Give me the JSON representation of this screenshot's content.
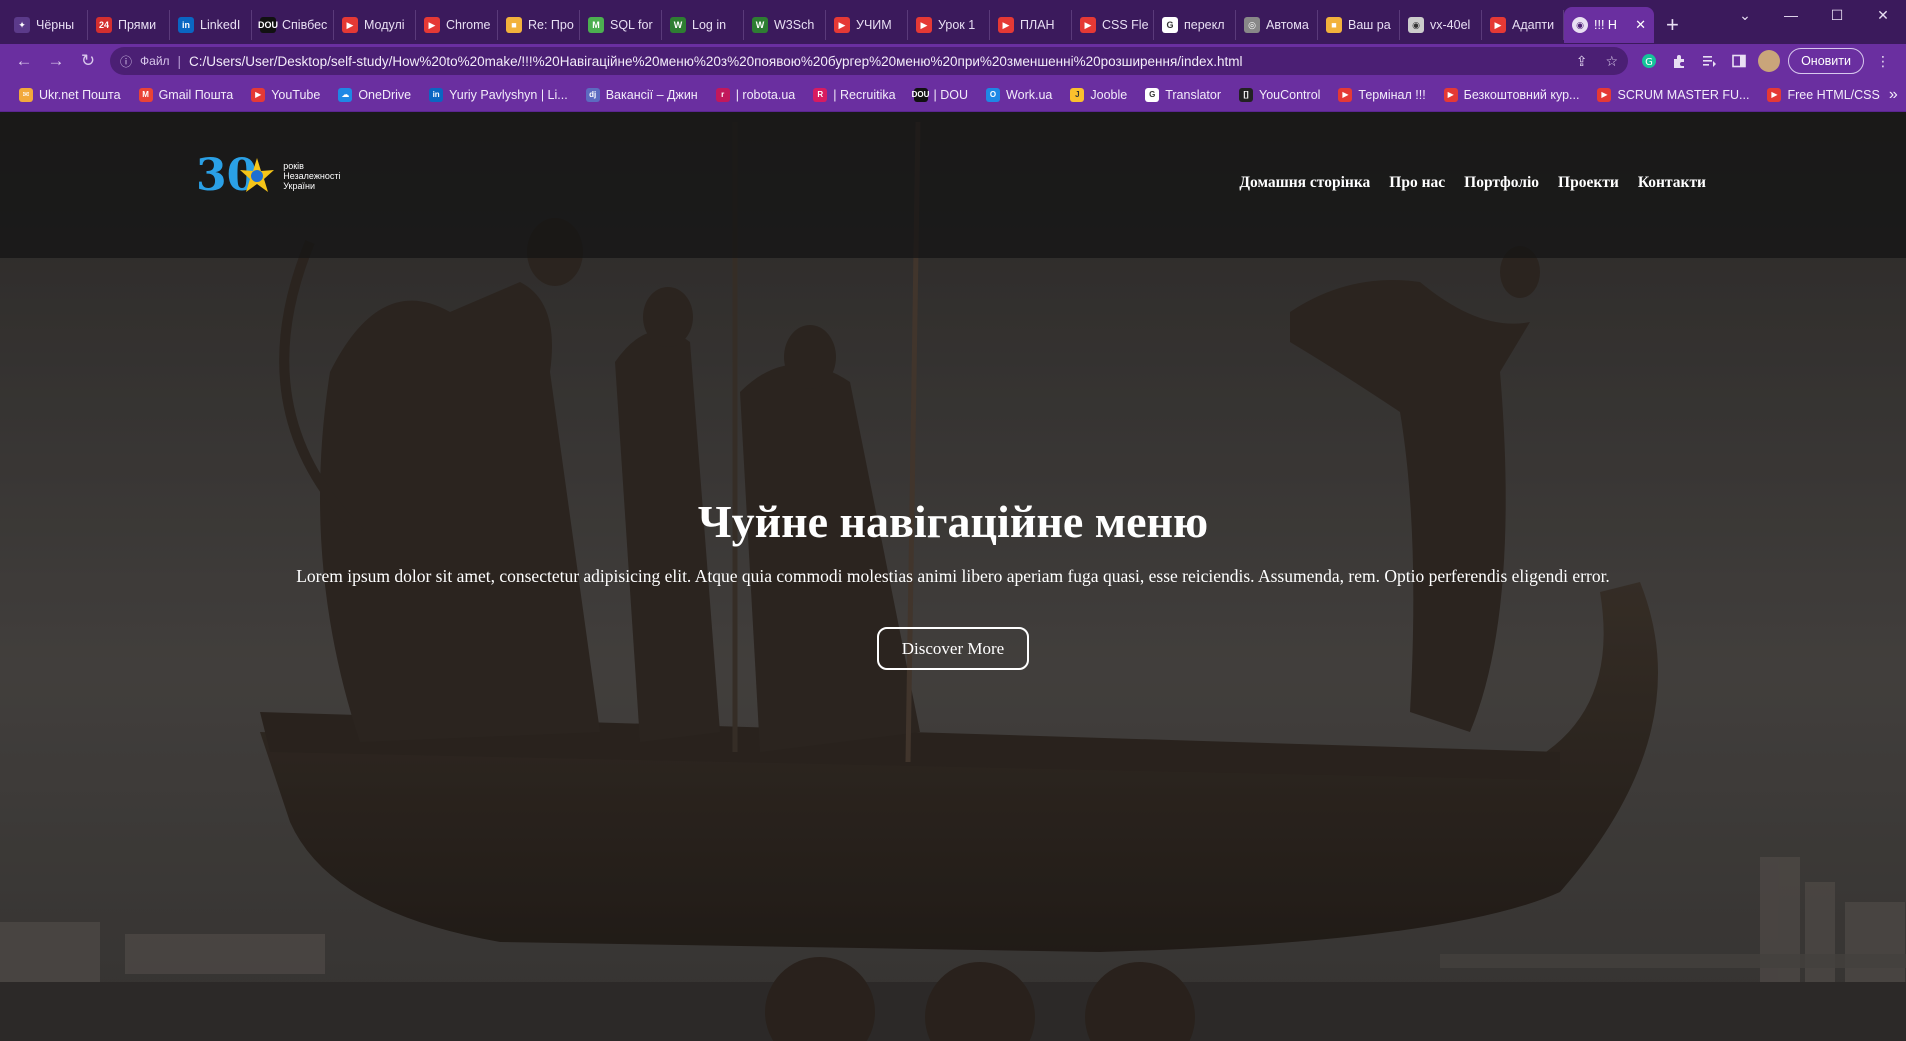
{
  "browser": {
    "tabs": [
      {
        "label": "Чёрны",
        "fav_color": "#5b3a8a",
        "fav_text": "✦"
      },
      {
        "label": "Прями",
        "fav_color": "#d32f2f",
        "fav_text": "24"
      },
      {
        "label": "LinkedI",
        "fav_color": "#0a66c2",
        "fav_text": "in"
      },
      {
        "label": "Співбес",
        "fav_color": "#111111",
        "fav_text": "DOU"
      },
      {
        "label": "Модулі",
        "fav_color": "#e53935",
        "fav_text": "▶"
      },
      {
        "label": "Chrome",
        "fav_color": "#e53935",
        "fav_text": "▶"
      },
      {
        "label": "Re: Про",
        "fav_color": "#f2b23c",
        "fav_text": "■"
      },
      {
        "label": "SQL for",
        "fav_color": "#4caf50",
        "fav_text": "M"
      },
      {
        "label": "Log in",
        "fav_color": "#2e7d32",
        "fav_text": "W"
      },
      {
        "label": "W3Sch",
        "fav_color": "#2e7d32",
        "fav_text": "W"
      },
      {
        "label": "УЧИМ",
        "fav_color": "#e53935",
        "fav_text": "▶"
      },
      {
        "label": "Урок 1",
        "fav_color": "#e53935",
        "fav_text": "▶"
      },
      {
        "label": "ПЛАН",
        "fav_color": "#e53935",
        "fav_text": "▶"
      },
      {
        "label": "CSS Fle",
        "fav_color": "#e53935",
        "fav_text": "▶"
      },
      {
        "label": "перекл",
        "fav_color": "#ffffff",
        "fav_text": "G"
      },
      {
        "label": "Автома",
        "fav_color": "#888888",
        "fav_text": "◎"
      },
      {
        "label": "Ваш ра",
        "fav_color": "#f2b23c",
        "fav_text": "■"
      },
      {
        "label": "vx-40el",
        "fav_color": "#cccccc",
        "fav_text": "◉"
      },
      {
        "label": "Адапти",
        "fav_color": "#e53935",
        "fav_text": "▶"
      }
    ],
    "active_tab": {
      "label": "!!! Н",
      "close": "✕"
    },
    "new_tab": "+",
    "window_controls": {
      "menu": "⌄",
      "minimize": "—",
      "maximize": "☐",
      "close": "✕"
    },
    "toolbar": {
      "back": "←",
      "forward": "→",
      "reload": "↻",
      "info_icon": "ⓘ",
      "scheme_label": "Файл",
      "url": "C:/Users/User/Desktop/self-study/How%20to%20make/!!!%20Навігаційне%20меню%20з%20появою%20бургер%20меню%20при%20зменшенні%20розширення/index.html",
      "share_icon": "⇪",
      "star_icon": "☆",
      "update_label": "Оновити",
      "more": "⋮"
    },
    "bookmarks": [
      {
        "label": "Ukr.net Пошта",
        "color": "#f2a93b",
        "glyph": "✉"
      },
      {
        "label": "Gmail Пошта",
        "color": "#ea4335",
        "glyph": "M"
      },
      {
        "label": "YouTube",
        "color": "#e53935",
        "glyph": "▶"
      },
      {
        "label": "OneDrive",
        "color": "#1e88e5",
        "glyph": "☁"
      },
      {
        "label": "Yuriy Pavlyshyn | Li...",
        "color": "#0a66c2",
        "glyph": "in"
      },
      {
        "label": "Вакансії – Джин",
        "color": "#5c6bc0",
        "glyph": "dj"
      },
      {
        "label": "| robota.ua",
        "color": "#c2185b",
        "glyph": "r"
      },
      {
        "label": "| Recruitika",
        "color": "#d81b60",
        "glyph": "R"
      },
      {
        "label": "| DOU",
        "color": "#111111",
        "glyph": "DOU"
      },
      {
        "label": "Work.ua",
        "color": "#1e88e5",
        "glyph": "O"
      },
      {
        "label": "Jooble",
        "color": "#fbc02d",
        "glyph": "J"
      },
      {
        "label": "Translator",
        "color": "#ffffff",
        "glyph": "G"
      },
      {
        "label": "YouControl",
        "color": "#222222",
        "glyph": "[]"
      },
      {
        "label": "Термінал !!!",
        "color": "#e53935",
        "glyph": "▶"
      },
      {
        "label": "Безкоштовний кур...",
        "color": "#e53935",
        "glyph": "▶"
      },
      {
        "label": "SCRUM MASTER FU...",
        "color": "#e53935",
        "glyph": "▶"
      },
      {
        "label": "Free HTML/CSS",
        "color": "#e53935",
        "glyph": "▶"
      }
    ],
    "bookmarks_more": "»"
  },
  "page": {
    "logo": {
      "number": "30",
      "text_line1": "років",
      "text_line2": "Незалежності",
      "text_line3": "України"
    },
    "nav": [
      "Домашня сторінка",
      "Про нас",
      "Портфоліо",
      "Проекти",
      "Контакти"
    ],
    "hero": {
      "title": "Чуйне навігаційне меню",
      "subtitle": "Lorem ipsum dolor sit amet, consectetur adipisicing elit. Atque quia commodi molestias animi libero aperiam fuga quasi, esse reiciendis. Assumenda, rem. Optio perferendis eligendi error.",
      "button": "Discover More"
    }
  }
}
